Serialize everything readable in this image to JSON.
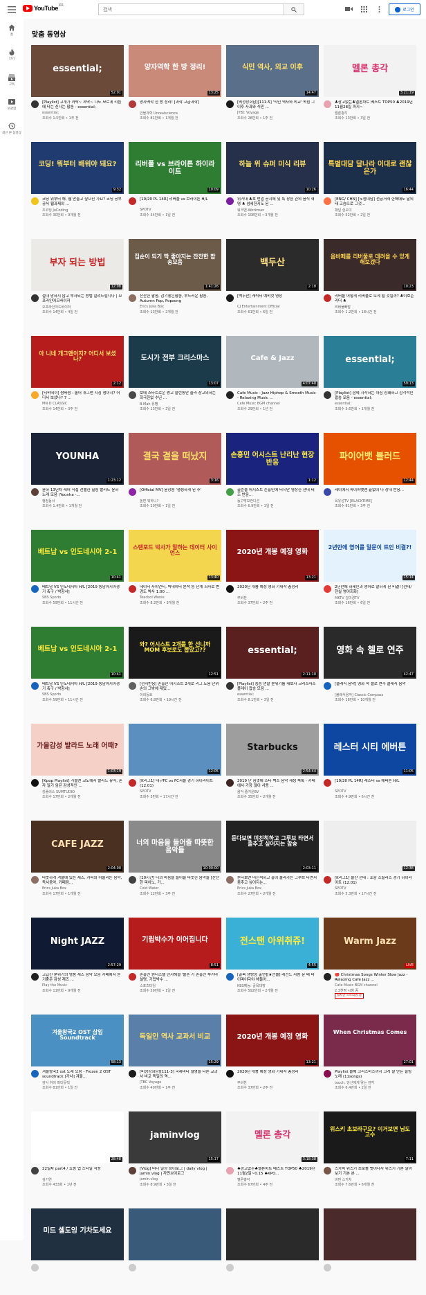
{
  "header": {
    "logo_text": "YouTube",
    "logo_region": "KR",
    "search_placeholder": "검색",
    "login_label": "로그인"
  },
  "sidebar": {
    "items": [
      {
        "label": "홈",
        "icon": "home-icon"
      },
      {
        "label": "인기",
        "icon": "trending-icon"
      },
      {
        "label": "구독",
        "icon": "subscriptions-icon"
      },
      {
        "label": "보관함",
        "icon": "library-icon"
      },
      {
        "label": "최근 본 동영상",
        "icon": "history-icon"
      }
    ]
  },
  "main": {
    "section_title": "맞춤 동영상"
  },
  "videos": [
    {
      "thumb_text": "essential;",
      "duration": "52:01",
      "title": "[Playlist] 고개가 까딱~ 까딱~ 나도 모르게 리듬에 타는 신나는 팝송 - essential;",
      "channel": "essential;",
      "stats": "조회수 1.5만회 • 1주 전",
      "bg": "#6b4a3a",
      "fg": "#ffffff",
      "avatar": "#333333"
    },
    {
      "thumb_text": "양자역학 한 방 정리!",
      "duration": "13:25",
      "title": "양자역학 한 방 정리! [과학·고급과학]",
      "channel": "안될과학 Unrealscience",
      "stats": "조회수 81만회 • 1개월 전",
      "bg": "#c98a7a",
      "fg": "#ffffff",
      "avatar": "#b23a3a"
    },
    {
      "thumb_text": "식민 역사, 외교 이후",
      "duration": "14:47",
      "title": "[비정상회담][111-5] '식민 역사와 외교' 독립 그 이후 사과와 식민 ...",
      "channel": "JTBC Voyage",
      "stats": "조회수 28만회 • 1주 전",
      "bg": "#5a6f8a",
      "fg": "#ffe066",
      "avatar": "#1a1a1a"
    },
    {
      "thumb_text": "멜론 총각",
      "duration": "3:21:19",
      "title": "♣광고없는♣멜론차트 베스트 TOP50 ♣2019년11월28일 까지~",
      "channel": "멜론총각",
      "stats": "조회수 13만회 • 3일 전",
      "bg": "#f2f2f2",
      "fg": "#d6336c",
      "avatar": "#e8a2b0"
    },
    {
      "thumb_text": "코딩! 뭐부터 배워야 돼요?",
      "duration": "9:32",
      "title": "코딩 뭐부터 해, 웹 만들고 싶으신 가요? 코딩 공부 공식 웹과제의 ...",
      "channel": "조코딩 JoCoding",
      "stats": "조회수 30만회 • 9개월 전",
      "bg": "#1f3b70",
      "fg": "#ffe066",
      "avatar": "#f0c419"
    },
    {
      "thumb_text": "리버풀 vs 브라이튼 하이라이트",
      "duration": "10:09",
      "title": "[19/20 PL 14R] 리버풀 vs 브라이튼 H/L",
      "channel": "SPOTV",
      "stats": "조회수 34만회 • 1일 전",
      "bg": "#2e7d32",
      "fg": "#ffffff",
      "avatar": "#c62828"
    },
    {
      "thumb_text": "하늘 위 슈퍼 미식 리뷰",
      "duration": "10:26",
      "title": "위거대 ♣호 번업 공지에 및 특 장승 관의 음식 혁명 ♣ 섬세한지도 된 ...",
      "channel": "워크맨-Workman",
      "stats": "조회수 108만회 • 3개월 전",
      "bg": "#26304a",
      "fg": "#ffe066",
      "avatar": "#7b1fa2"
    },
    {
      "thumb_text": "특별대담 달나라 이대로 괜찮은가",
      "duration": "16:44",
      "title": "[ENG/ CHN] [노썸대담] 전급거래 한해에도 달의 태 고슴으로 그것...",
      "channel": "채널 십오야",
      "stats": "조회수 52만회 • 2일 전",
      "bg": "#1b2e4a",
      "fg": "#ffd54f",
      "avatar": "#ff7043"
    },
    {
      "thumb_text": "부자 되는 방법",
      "duration": "12:08",
      "title": "절대 망하지 않고 부자되는 방법 알려드립니다 | 오프라인어드바이저",
      "channel": "오프라인어드바이저",
      "stats": "조회수 14만회 • 4일 전",
      "bg": "#eceae6",
      "fg": "#c62828",
      "avatar": "#333333"
    },
    {
      "thumb_text": "집순이 되기 딱 좋아지는 잔잔한 팝송모음",
      "duration": "1:41:26",
      "title": "잔잔한 팝송, 감기좋은팝송, 부드러운 팝송, Autumn Pop, Popsong",
      "channel": "Erics Juka Box",
      "stats": "조회수 13만회 • 2개월 전",
      "bg": "#6d5b4a",
      "fg": "#ffffff",
      "avatar": "#8d6e63"
    },
    {
      "thumb_text": "백두산",
      "duration": "2:18",
      "title": "[백두산] 캐릭터 예비컷 영상",
      "channel": "CJ Entertainment Official",
      "stats": "조회수 61만회 • 6일 전",
      "bg": "#2b2b2b",
      "fg": "#ffe082",
      "avatar": "#1a1a1a"
    },
    {
      "thumb_text": "음바페를 리버풀로 데려올 수 있게 해보겠다",
      "duration": "10:23",
      "title": "리버풀 어떻게 리버풀로 오게 될 것일까? ♣이호준 리더 ♣",
      "channel": "리버풀빠밥",
      "stats": "조회수 1.2만회 • 18시간 전",
      "bg": "#3a2a2a",
      "fg": "#ffd54f",
      "avatar": "#c62828"
    },
    {
      "thumb_text": "아 니네 개그맨이지? 어디서 보셨나?",
      "duration": "2:12",
      "title": "[티비데이] 쌈바쌈 : 놀어 개그맨 지칭 생이지? 어디서 보셨나? 7 ...",
      "channel": "MN D CLASSIC",
      "stats": "조회수 14만회 • 3주 전",
      "bg": "#b71c1c",
      "fg": "#ffe066",
      "avatar": "#f9a825"
    },
    {
      "thumb_text": "도시가 전부 크리스마스",
      "duration": "13:07",
      "title": "보에 스타트로운 쌍고 말린동안 슬라 창고의하는 희극한없 수년 ...",
      "channel": "B.Mah 뮤뺑",
      "stats": "조회수 13만회 • 2일 전",
      "bg": "#1b3a4a",
      "fg": "#ffffff",
      "avatar": "#4a4a4a"
    },
    {
      "thumb_text": "Cafe & Jazz",
      "duration": "4:07:40",
      "title": "Cafe Music - Jazz Hiphop & Smooth Music - Relaxing Music ...",
      "channel": "Cafe Music BGM channel",
      "stats": "조회수 29만회 • 1년 전",
      "bg": "#b0b8bd",
      "fg": "#ffffff",
      "avatar": "#222222"
    },
    {
      "thumb_text": "essential;",
      "duration": "59:13",
      "title": "[Playlist] 함께 시작하는 아침 상쾌하고 감각적인 팝송 모음 - essential;",
      "channel": "essential;",
      "stats": "조회수 3.6만회 • 1개월 전",
      "bg": "#2a7f96",
      "fg": "#ffffff",
      "avatar": "#333333"
    },
    {
      "thumb_text": "YOUNHA",
      "duration": "1:23:12",
      "title": "윤하 13년차 레어 직접 선별한 힐링 발라드 윤하 노래 모음 (Younha -...",
      "channel": "행정동서",
      "stats": "조회수 1.4만회 • 1개월 전",
      "bg": "#1a2436",
      "fg": "#ffffff",
      "avatar": "#5d4037"
    },
    {
      "thumb_text": "결국 곁을 떠났지",
      "duration": "3:16",
      "title": "[Official MV] 윤상송 '행쟁하게 된 후'",
      "channel": "놀면 뭐하니?",
      "stats": "조회수 20만회 • 1일 전",
      "bg": "#b05a5a",
      "fg": "#ffe066",
      "avatar": "#8e24aa"
    },
    {
      "thumb_text": "손흥민 어시스트 난리난 현장 반응",
      "duration": "1:12",
      "title": "골순을 어시스트 손흥민에 터지만 영상한 현대 테즈 반응...",
      "channel": "동구밖모컨디션",
      "stats": "조회수 6.9만회 • 1일 전",
      "bg": "#1a237e",
      "fg": "#ffeb3b",
      "avatar": "#43a047"
    },
    {
      "thumb_text": "파이어뱃 블러드",
      "duration": "12:44",
      "title": "레이에서 파이어뱃맨 끝없이 나 상대 반응...",
      "channel": "육유성TV [BLACKTIME]",
      "stats": "조회수 81만회 • 3주 전",
      "bg": "#e65100",
      "fg": "#fff176",
      "avatar": "#3949ab"
    },
    {
      "thumb_text": "베트남 vs 인도네시아 2-1",
      "duration": "10:41",
      "title": "베트남 VS 인도네시아 H/L [2019 동남아시아경기 축구 / 박항서]",
      "channel": "SBS Sports",
      "stats": "조회수 59만회 • 11시간 전",
      "bg": "#2e7d32",
      "fg": "#ffeb3b",
      "avatar": "#1565c0"
    },
    {
      "thumb_text": "스탠포드 박사가 말하는 데이터 사이언스",
      "duration": "13:40",
      "title": "데이터 사이언티, 빅데이터 분석 등 단계 회사로 변경도 박사 1.00 ...",
      "channel": "Teacbol Wonie",
      "stats": "조회수 8.2만회 • 3개월 전",
      "bg": "#f3d54e",
      "fg": "#c62828",
      "avatar": "#c62828"
    },
    {
      "thumb_text": "2020년 개봉 예정 영화",
      "duration": "13:21",
      "title": "2020년 개봉 예정 영화 기대작 총정리",
      "channel": "무비찬",
      "stats": "조회수 37만회 • 2주 전",
      "bg": "#8b1414",
      "fg": "#ffffff",
      "avatar": "#111111"
    },
    {
      "thumb_text": "2년만에 영어를 말문이 트인 비결?!",
      "duration": "15:14",
      "title": "2년만에 하세인과 영어로 말하게 된 비결! [현대/현실 영어회화]",
      "channel": "MKTV 김미경TV",
      "stats": "조회수 16만회 • 6일 전",
      "bg": "#e3f2fd",
      "fg": "#0d47a1",
      "avatar": "#e53935"
    },
    {
      "thumb_text": "베트남 vs 인도네시아 2-1",
      "duration": "10:41",
      "title": "베트남 VS 인도네시아 H/L [2019 동남아시아경기 축구 / 박항서]",
      "channel": "SBS Sports",
      "stats": "조회수 59만회 • 11시간 전",
      "bg": "#2e7d32",
      "fg": "#ffeb3b",
      "avatar": "#1565c0"
    },
    {
      "thumb_text": "와? 어시스트 2개를 한 선니까 MOM 후보로도 뽑았고??",
      "duration": "12:51",
      "title": "[현지반응] 손흥민 어시스트 2개로 리그 도움 단위 손의 그밖에 재밌...",
      "channel": "이리둥호",
      "stats": "조회수 6.8만회 • 19시간 전",
      "bg": "#1a1a1a",
      "fg": "#ffeb3b",
      "avatar": "#616161"
    },
    {
      "thumb_text": "essential;",
      "duration": "2:11:10",
      "title": "[Playlist] 송승 연말 분위기를 내보자 크리스마스 플레이 팝송 모음 ...",
      "channel": "essential;",
      "stats": "조회수 8.1만회 • 3일 전",
      "bg": "#5a2020",
      "fg": "#ffffff",
      "avatar": "#333333"
    },
    {
      "thumb_text": "영화 속 첼로 연주",
      "duration": "42:47",
      "title": "[클래식 음악] 영화 속 첼로 연주 클래식 음악",
      "channel": "[블래식음악] Classic Compass",
      "stats": "조회수 18만회 • 10개월 전",
      "bg": "#2a2a2a",
      "fg": "#ffffff",
      "avatar": "#1565c0"
    },
    {
      "thumb_text": "가을감성 발라드 노래 어때?",
      "duration": "1:03:19",
      "title": "[Kpop Playlist] 가을엔 코노에서 발라드 뮤직, 혼자 일기 임은 감성적인 ...",
      "channel": "쏭플러스 SUMTUDIO",
      "stats": "조회수 17만회 • 2개월 전",
      "bg": "#f4d0c6",
      "fg": "#6a1b1b",
      "avatar": "#111111"
    },
    {
      "thumb_text": "",
      "duration": "12:05",
      "title": "[K리그1] 대구FC vs FC서울 경기 하이라이트 (12.01)",
      "channel": "SPOTV",
      "stats": "조회수 3만회 • 17시간 전",
      "bg": "#5b8fbf",
      "fg": "#ffffff",
      "avatar": "#c62828"
    },
    {
      "thumb_text": "Starbucks",
      "duration": "2:54:44",
      "title": "2019 난 힘껏에 스타 벅스 음악 재생 목록 - 카페에서 가장 많이 사용 ...",
      "channel": "음악 즐거운BV",
      "stats": "조회수 35만회 • 2개월 전",
      "bg": "#9e9e9e",
      "fg": "#111111",
      "avatar": "#3e2723"
    },
    {
      "thumb_text": "레스터 시티 에버튼",
      "duration": "11:05",
      "title": "[19/20 PL 14R] 레스터 vs 에버튼 H/L",
      "channel": "SPOTV",
      "stats": "조회수 4.9만회 • 6시간 전",
      "bg": "#0d47a1",
      "fg": "#ffffff",
      "avatar": "#c62828"
    },
    {
      "thumb_text": "CAFE JAZZ",
      "duration": "2:04:00",
      "title": "따뜻하게 겨울에 있는 재즈, 커피와 어울리는 음악, 독서음악, 카페음...",
      "channel": "Erics Juka Box",
      "stats": "조회수 17만회 • 1개월 전",
      "bg": "#4a3020",
      "fg": "#ffe0b2",
      "avatar": "#8d6e63"
    },
    {
      "thumb_text": "너의 마음을 들어줄 따뜻한 음악들",
      "duration": "10:00:00",
      "title": "[10시간] 너의 마음을 들어줄 따뜻한 음악들 [잔잔한 피아노, 가...",
      "channel": "Cold Water",
      "stats": "조회수 12만회 • 3주 전",
      "bg": "#8a8a8a",
      "fg": "#ffffff",
      "avatar": "#424242"
    },
    {
      "thumb_text": "듣다보면 미친척하고 그루브 타면서 출추고 싶어지는 팝송",
      "duration": "2:03:11",
      "title": "듣다보면 미친척하고 흥이 올라가는 그루브 타면서 춤추고 싶어지는...",
      "channel": "Erics Juka Box",
      "stats": "조회수 27만회 • 2개월 전",
      "bg": "#222222",
      "fg": "#ffffff",
      "avatar": "#8d6e63"
    },
    {
      "thumb_text": "",
      "duration": "12:38",
      "title": "[K리그1] 울산 현대 : 포항 스틸러스 경기 하이라이트 (12.01)",
      "channel": "SPOTV",
      "stats": "조회수 5.3만회 • 17시간 전",
      "bg": "#eeeeee",
      "fg": "#111111",
      "avatar": "#c62828"
    },
    {
      "thumb_text": "Night JAZZ",
      "duration": "2:57:29",
      "title": "고급진 분위기의 명품 재즈 음악 모음 카페에서 듣기좋은 감성 재즈 ...",
      "channel": "Play the Music",
      "stats": "조회수 11만회 • 9개월 전",
      "bg": "#101a33",
      "fg": "#ffffff",
      "avatar": "#212121"
    },
    {
      "thumb_text": "기립박수가 이어집니다",
      "duration": "8:51",
      "title": "손흥민 원더스텔 현지해설 '볼손 가 손흥민 부커마 설명, 기립박수 ...",
      "channel": "스포츠타임",
      "stats": "조회수 59만회 • 1일 전",
      "bg": "#b71c1c",
      "fg": "#ffffff",
      "avatar": "#c62828"
    },
    {
      "thumb_text": "전스탠 아위취쥬!",
      "duration": "4:55",
      "title": "[골목 생방송 출연][★전솔] 레전드 사람 문 배 바이며이다야 해들어...",
      "channel": "KBS예능: 골목대장",
      "stats": "조회수 592만회 • 2개월 전",
      "bg": "#3ab0d6",
      "fg": "#ffeb3b",
      "avatar": "#1565c0"
    },
    {
      "thumb_text": "Warm Jazz",
      "duration": "LIVE",
      "title": "🔴 Christmas Songs Winter Slow Jazz - Relaxing Cafe Jazz ...",
      "channel": "Cafe Music BGM channel",
      "stats": "2.3천명 시청 중",
      "live": "실시간 스트리밍 중",
      "bg": "#6b3a1a",
      "fg": "#ffe0b2",
      "avatar": "#222222"
    },
    {
      "thumb_text": "겨울왕국2 OST 삽입 Soundtrack",
      "duration": "58:13",
      "title": "겨울왕국2 ost 노래 모음 - Frozen 2 OST soundtrack [가사] 겨울...",
      "channel": "감사 하이 파티뮤직",
      "stats": "조회수 81만회 • 1일 전",
      "bg": "#4a90c2",
      "fg": "#ffffff",
      "avatar": "#1565c0"
    },
    {
      "thumb_text": "독일인 역사 교과서 비교",
      "duration": "15:29",
      "title": "[비정상회담][111-3] 국제마다 설명을 다른 교과서 비교 독일의 역...",
      "channel": "JTBC Voyage",
      "stats": "조회수 40만회 • 1주 전",
      "bg": "#5a7fa8",
      "fg": "#ffe066",
      "avatar": "#1a1a1a"
    },
    {
      "thumb_text": "2020년 개봉 예정 영화",
      "duration": "13:21",
      "title": "2020년 개봉 예정 영화 기대작 총정리",
      "channel": "무비찬",
      "stats": "조회수 37만회 • 2주 전",
      "bg": "#8b1414",
      "fg": "#ffffff",
      "avatar": "#111111"
    },
    {
      "thumb_text": "When Christmas Comes",
      "duration": "27:01",
      "title": "Playlist 올해 크리스마스까지 크게 살 만든 힐링 노래 (11songs)",
      "channel": "touch, 당신에게 닿는 감각",
      "stats": "조회수 6.4만회 • 2일 전",
      "bg": "#7a2a4a",
      "fg": "#ffffff",
      "avatar": "#880e4f"
    },
    {
      "thumb_text": "",
      "duration": "28:48",
      "title": "22일차 part4 / 쇼핑 앱 스타일 작성",
      "channel": "김기연",
      "stats": "조회수 433회 • 1년 전",
      "bg": "#ffffff",
      "fg": "#111111",
      "avatar": "#424242"
    },
    {
      "thumb_text": "jaminvlog",
      "duration": "15:17",
      "title": "[Vlog] 떠나 일상 브이로그 | daily vlog | jamin.vlog | 자민브이로그",
      "channel": "jamin.vlog",
      "stats": "조회수 8.9만회 • 3일 전",
      "bg": "#3a3a3a",
      "fg": "#ffffff",
      "avatar": "#5d4037"
    },
    {
      "thumb_text": "멜론 총각",
      "duration": "3:18:38",
      "title": "♣광고없는♣멜론차트 베스트 TOP50 ♣2019년11월2일~0.15 ♣KPO...",
      "channel": "멜론총각",
      "stats": "조회수 67만회 • 4주 전",
      "bg": "#f2f2f2",
      "fg": "#d6336c",
      "avatar": "#e8a2b0"
    },
    {
      "thumb_text": "위스키 초보라구요? 이거보면 님도 고수",
      "duration": "7:11",
      "title": "스카치 위스키 초보를 벗어나자 위스키 기본 알아보기 기본 본 ...",
      "channel": "버번 스카치",
      "stats": "조회수 7.6만회 • 6개월 전",
      "bg": "#1a1a1a",
      "fg": "#ffeb3b",
      "avatar": "#795548"
    },
    {
      "thumb_text": "미드 셀도잉 기차도세요",
      "duration": "",
      "title": "",
      "channel": "",
      "stats": "",
      "bg": "#203040",
      "fg": "#ffffff",
      "avatar": "#cccccc"
    },
    {
      "thumb_text": "",
      "duration": "",
      "title": "",
      "channel": "",
      "stats": "",
      "bg": "#3a5a7a",
      "fg": "#ffffff",
      "avatar": "#cccccc"
    },
    {
      "thumb_text": "",
      "duration": "",
      "title": "",
      "channel": "",
      "stats": "",
      "bg": "#2a2a2a",
      "fg": "#ffffff",
      "avatar": "#cccccc"
    },
    {
      "thumb_text": "",
      "duration": "",
      "title": "",
      "channel": "",
      "stats": "",
      "bg": "#4a2a2a",
      "fg": "#ffffff",
      "avatar": "#cccccc"
    }
  ]
}
